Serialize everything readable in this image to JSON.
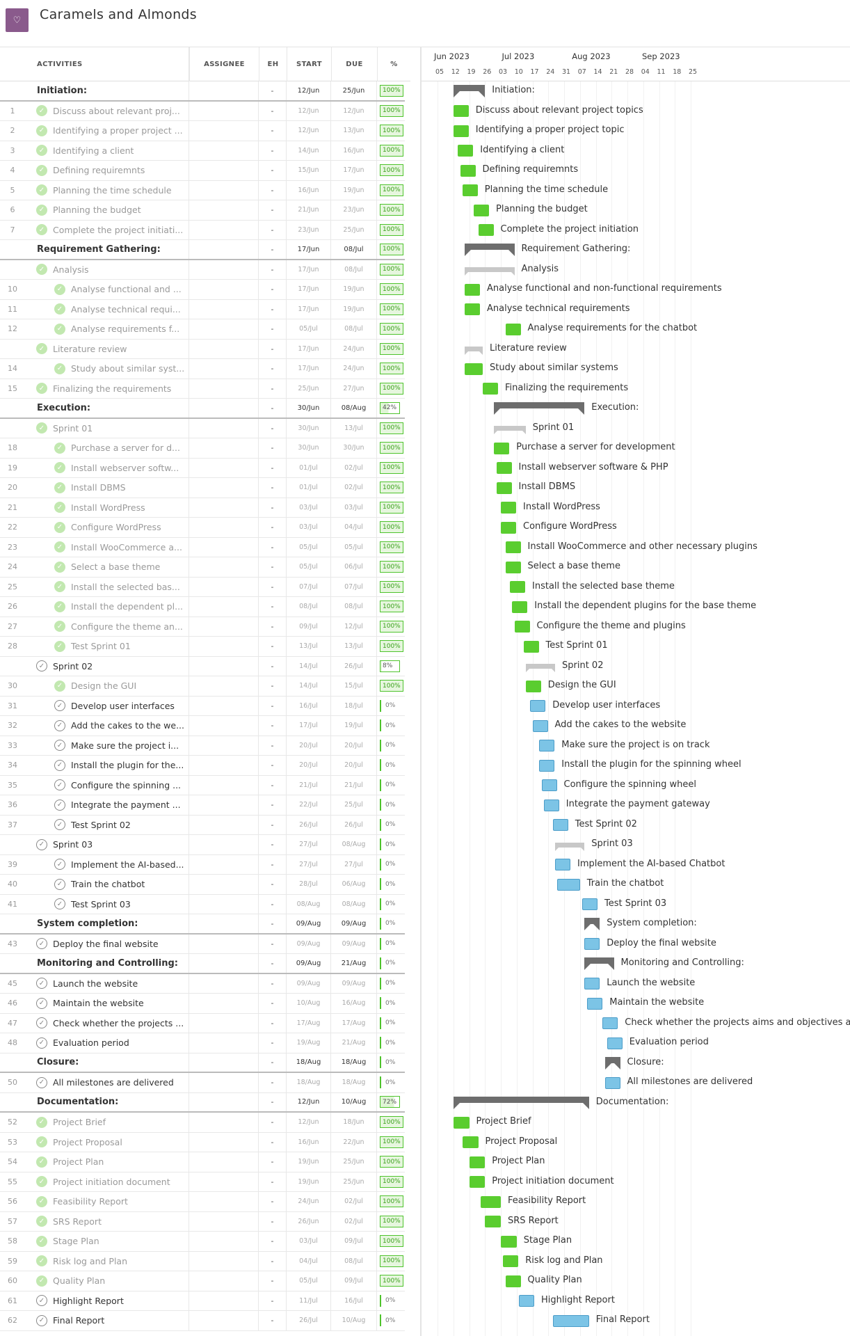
{
  "app": {
    "title": "Caramels and Almonds",
    "logo_icon": "heart-logo-icon"
  },
  "columns": {
    "activities": "ACTIVITIES",
    "assignee": "ASSIGNEE",
    "eh": "EH",
    "start": "START",
    "due": "DUE",
    "percent": "%"
  },
  "timeline": {
    "months": [
      "Jun 2023",
      "Jul 2023",
      "Aug 2023",
      "Sep 2023"
    ],
    "days": [
      "05",
      "12",
      "19",
      "26",
      "03",
      "10",
      "17",
      "24",
      "31",
      "07",
      "14",
      "21",
      "28",
      "04",
      "11",
      "18",
      "25"
    ]
  },
  "colors": {
    "done": "#5acd2f",
    "open": "#7cc4e6",
    "summary": "#6d6d6d",
    "subgroup": "#c8c8c8"
  },
  "rows": [
    {
      "num": "",
      "name": "Initiation:",
      "short": "Initiation:",
      "eh": "-",
      "start": "12/Jun",
      "due": "25/Jun",
      "pct": "100%",
      "type": "group",
      "level": 0
    },
    {
      "num": "1",
      "name": "Discuss about relevant project topics",
      "short": "Discuss about relevant proj...",
      "eh": "-",
      "start": "12/Jun",
      "due": "12/Jun",
      "pct": "100%",
      "type": "task",
      "level": 1
    },
    {
      "num": "2",
      "name": "Identifying a proper project topic",
      "short": "Identifying a proper project ...",
      "eh": "-",
      "start": "12/Jun",
      "due": "13/Jun",
      "pct": "100%",
      "type": "task",
      "level": 1
    },
    {
      "num": "3",
      "name": "Identifying a client",
      "short": "Identifying a client",
      "eh": "-",
      "start": "14/Jun",
      "due": "16/Jun",
      "pct": "100%",
      "type": "task",
      "level": 1
    },
    {
      "num": "4",
      "name": "Defining requiremnts",
      "short": "Defining requiremnts",
      "eh": "-",
      "start": "15/Jun",
      "due": "17/Jun",
      "pct": "100%",
      "type": "task",
      "level": 1
    },
    {
      "num": "5",
      "name": "Planning the time schedule",
      "short": "Planning the time schedule",
      "eh": "-",
      "start": "16/Jun",
      "due": "19/Jun",
      "pct": "100%",
      "type": "task",
      "level": 1
    },
    {
      "num": "6",
      "name": "Planning the budget",
      "short": "Planning the budget",
      "eh": "-",
      "start": "21/Jun",
      "due": "23/Jun",
      "pct": "100%",
      "type": "task",
      "level": 1
    },
    {
      "num": "7",
      "name": "Complete the project initiation",
      "short": "Complete the project initiati...",
      "eh": "-",
      "start": "23/Jun",
      "due": "25/Jun",
      "pct": "100%",
      "type": "task",
      "level": 1
    },
    {
      "num": "",
      "name": "Requirement Gathering:",
      "short": "Requirement Gathering:",
      "eh": "-",
      "start": "17/Jun",
      "due": "08/Jul",
      "pct": "100%",
      "type": "group",
      "level": 0
    },
    {
      "num": "",
      "name": "Analysis",
      "short": "Analysis",
      "eh": "-",
      "start": "17/Jun",
      "due": "08/Jul",
      "pct": "100%",
      "type": "sub",
      "level": 1
    },
    {
      "num": "10",
      "name": "Analyse functional and non-functional requirements",
      "short": "Analyse functional and ...",
      "eh": "-",
      "start": "17/Jun",
      "due": "19/Jun",
      "pct": "100%",
      "type": "task",
      "level": 2
    },
    {
      "num": "11",
      "name": "Analyse technical requirements",
      "short": "Analyse technical requi...",
      "eh": "-",
      "start": "17/Jun",
      "due": "19/Jun",
      "pct": "100%",
      "type": "task",
      "level": 2
    },
    {
      "num": "12",
      "name": "Analyse requirements for the chatbot",
      "short": "Analyse requirements f...",
      "eh": "-",
      "start": "05/Jul",
      "due": "08/Jul",
      "pct": "100%",
      "type": "task",
      "level": 2
    },
    {
      "num": "",
      "name": "Literature review",
      "short": "Literature review",
      "eh": "-",
      "start": "17/Jun",
      "due": "24/Jun",
      "pct": "100%",
      "type": "sub",
      "level": 1
    },
    {
      "num": "14",
      "name": "Study about similar systems",
      "short": "Study about similar syst...",
      "eh": "-",
      "start": "17/Jun",
      "due": "24/Jun",
      "pct": "100%",
      "type": "task",
      "level": 2
    },
    {
      "num": "15",
      "name": "Finalizing the requirements",
      "short": "Finalizing the requirements",
      "eh": "-",
      "start": "25/Jun",
      "due": "27/Jun",
      "pct": "100%",
      "type": "task",
      "level": 1
    },
    {
      "num": "",
      "name": "Execution:",
      "short": "Execution:",
      "eh": "-",
      "start": "30/Jun",
      "due": "08/Aug",
      "pct": "42%",
      "type": "group",
      "level": 0
    },
    {
      "num": "",
      "name": "Sprint 01",
      "short": "Sprint 01",
      "eh": "-",
      "start": "30/Jun",
      "due": "13/Jul",
      "pct": "100%",
      "type": "sub",
      "level": 1
    },
    {
      "num": "18",
      "name": "Purchase a server for development",
      "short": "Purchase a server for d...",
      "eh": "-",
      "start": "30/Jun",
      "due": "30/Jun",
      "pct": "100%",
      "type": "task",
      "level": 2
    },
    {
      "num": "19",
      "name": "Install webserver software & PHP",
      "short": "Install webserver softw...",
      "eh": "-",
      "start": "01/Jul",
      "due": "02/Jul",
      "pct": "100%",
      "type": "task",
      "level": 2
    },
    {
      "num": "20",
      "name": "Install DBMS",
      "short": "Install DBMS",
      "eh": "-",
      "start": "01/Jul",
      "due": "02/Jul",
      "pct": "100%",
      "type": "task",
      "level": 2
    },
    {
      "num": "21",
      "name": "Install WordPress",
      "short": "Install WordPress",
      "eh": "-",
      "start": "03/Jul",
      "due": "03/Jul",
      "pct": "100%",
      "type": "task",
      "level": 2
    },
    {
      "num": "22",
      "name": "Configure WordPress",
      "short": "Configure WordPress",
      "eh": "-",
      "start": "03/Jul",
      "due": "04/Jul",
      "pct": "100%",
      "type": "task",
      "level": 2
    },
    {
      "num": "23",
      "name": "Install WooCommerce and other necessary plugins",
      "short": "Install WooCommerce a...",
      "eh": "-",
      "start": "05/Jul",
      "due": "05/Jul",
      "pct": "100%",
      "type": "task",
      "level": 2
    },
    {
      "num": "24",
      "name": "Select a base theme",
      "short": "Select a base theme",
      "eh": "-",
      "start": "05/Jul",
      "due": "06/Jul",
      "pct": "100%",
      "type": "task",
      "level": 2
    },
    {
      "num": "25",
      "name": "Install the selected base theme",
      "short": "Install the selected bas...",
      "eh": "-",
      "start": "07/Jul",
      "due": "07/Jul",
      "pct": "100%",
      "type": "task",
      "level": 2
    },
    {
      "num": "26",
      "name": "Install the dependent plugins for the base theme",
      "short": "Install the dependent pl...",
      "eh": "-",
      "start": "08/Jul",
      "due": "08/Jul",
      "pct": "100%",
      "type": "task",
      "level": 2
    },
    {
      "num": "27",
      "name": "Configure the theme and plugins",
      "short": "Configure the theme an...",
      "eh": "-",
      "start": "09/Jul",
      "due": "12/Jul",
      "pct": "100%",
      "type": "task",
      "level": 2
    },
    {
      "num": "28",
      "name": "Test Sprint 01",
      "short": "Test Sprint 01",
      "eh": "-",
      "start": "13/Jul",
      "due": "13/Jul",
      "pct": "100%",
      "type": "task",
      "level": 2
    },
    {
      "num": "",
      "name": "Sprint 02",
      "short": "Sprint 02",
      "eh": "-",
      "start": "14/Jul",
      "due": "26/Jul",
      "pct": "8%",
      "type": "sub",
      "level": 1
    },
    {
      "num": "30",
      "name": "Design the GUI",
      "short": "Design the GUI",
      "eh": "-",
      "start": "14/Jul",
      "due": "15/Jul",
      "pct": "100%",
      "type": "task",
      "level": 2
    },
    {
      "num": "31",
      "name": "Develop user interfaces",
      "short": "Develop user interfaces",
      "eh": "-",
      "start": "16/Jul",
      "due": "18/Jul",
      "pct": "0%",
      "type": "task",
      "level": 2
    },
    {
      "num": "32",
      "name": "Add the cakes to the website",
      "short": "Add the cakes to the we...",
      "eh": "-",
      "start": "17/Jul",
      "due": "19/Jul",
      "pct": "0%",
      "type": "task",
      "level": 2
    },
    {
      "num": "33",
      "name": "Make sure the project is on track",
      "short": "Make sure the project i...",
      "eh": "-",
      "start": "20/Jul",
      "due": "20/Jul",
      "pct": "0%",
      "type": "task",
      "level": 2
    },
    {
      "num": "34",
      "name": "Install the plugin for the spinning wheel",
      "short": "Install the plugin for the...",
      "eh": "-",
      "start": "20/Jul",
      "due": "20/Jul",
      "pct": "0%",
      "type": "task",
      "level": 2
    },
    {
      "num": "35",
      "name": "Configure the spinning wheel",
      "short": "Configure the spinning ...",
      "eh": "-",
      "start": "21/Jul",
      "due": "21/Jul",
      "pct": "0%",
      "type": "task",
      "level": 2
    },
    {
      "num": "36",
      "name": "Integrate the payment gateway",
      "short": "Integrate the payment ...",
      "eh": "-",
      "start": "22/Jul",
      "due": "25/Jul",
      "pct": "0%",
      "type": "task",
      "level": 2
    },
    {
      "num": "37",
      "name": "Test Sprint 02",
      "short": "Test Sprint 02",
      "eh": "-",
      "start": "26/Jul",
      "due": "26/Jul",
      "pct": "0%",
      "type": "task",
      "level": 2
    },
    {
      "num": "",
      "name": "Sprint 03",
      "short": "Sprint 03",
      "eh": "-",
      "start": "27/Jul",
      "due": "08/Aug",
      "pct": "0%",
      "type": "sub",
      "level": 1
    },
    {
      "num": "39",
      "name": "Implement the AI-based Chatbot",
      "short": "Implement the AI-based...",
      "eh": "-",
      "start": "27/Jul",
      "due": "27/Jul",
      "pct": "0%",
      "type": "task",
      "level": 2
    },
    {
      "num": "40",
      "name": "Train the chatbot",
      "short": "Train the chatbot",
      "eh": "-",
      "start": "28/Jul",
      "due": "06/Aug",
      "pct": "0%",
      "type": "task",
      "level": 2
    },
    {
      "num": "41",
      "name": "Test Sprint 03",
      "short": "Test Sprint 03",
      "eh": "-",
      "start": "08/Aug",
      "due": "08/Aug",
      "pct": "0%",
      "type": "task",
      "level": 2
    },
    {
      "num": "",
      "name": "System completion:",
      "short": "System completion:",
      "eh": "-",
      "start": "09/Aug",
      "due": "09/Aug",
      "pct": "0%",
      "type": "group",
      "level": 0
    },
    {
      "num": "43",
      "name": "Deploy the final website",
      "short": "Deploy the final website",
      "eh": "-",
      "start": "09/Aug",
      "due": "09/Aug",
      "pct": "0%",
      "type": "task",
      "level": 1
    },
    {
      "num": "",
      "name": "Monitoring and Controlling:",
      "short": "Monitoring and Controlling:",
      "eh": "-",
      "start": "09/Aug",
      "due": "21/Aug",
      "pct": "0%",
      "type": "group",
      "level": 0
    },
    {
      "num": "45",
      "name": "Launch the website",
      "short": "Launch the website",
      "eh": "-",
      "start": "09/Aug",
      "due": "09/Aug",
      "pct": "0%",
      "type": "task",
      "level": 1
    },
    {
      "num": "46",
      "name": "Maintain the website",
      "short": "Maintain the website",
      "eh": "-",
      "start": "10/Aug",
      "due": "16/Aug",
      "pct": "0%",
      "type": "task",
      "level": 1
    },
    {
      "num": "47",
      "name": "Check whether the projects aims and objectives are met",
      "short": "Check whether the projects ...",
      "eh": "-",
      "start": "17/Aug",
      "due": "17/Aug",
      "pct": "0%",
      "type": "task",
      "level": 1
    },
    {
      "num": "48",
      "name": "Evaluation period",
      "short": "Evaluation period",
      "eh": "-",
      "start": "19/Aug",
      "due": "21/Aug",
      "pct": "0%",
      "type": "task",
      "level": 1
    },
    {
      "num": "",
      "name": "Closure:",
      "short": "Closure:",
      "eh": "-",
      "start": "18/Aug",
      "due": "18/Aug",
      "pct": "0%",
      "type": "group",
      "level": 0
    },
    {
      "num": "50",
      "name": "All milestones are delivered",
      "short": "All milestones are delivered",
      "eh": "-",
      "start": "18/Aug",
      "due": "18/Aug",
      "pct": "0%",
      "type": "task",
      "level": 1
    },
    {
      "num": "",
      "name": "Documentation:",
      "short": "Documentation:",
      "eh": "-",
      "start": "12/Jun",
      "due": "10/Aug",
      "pct": "72%",
      "type": "group",
      "level": 0
    },
    {
      "num": "52",
      "name": "Project Brief",
      "short": "Project Brief",
      "eh": "-",
      "start": "12/Jun",
      "due": "18/Jun",
      "pct": "100%",
      "type": "task",
      "level": 1
    },
    {
      "num": "53",
      "name": "Project Proposal",
      "short": "Project Proposal",
      "eh": "-",
      "start": "16/Jun",
      "due": "22/Jun",
      "pct": "100%",
      "type": "task",
      "level": 1
    },
    {
      "num": "54",
      "name": "Project Plan",
      "short": "Project Plan",
      "eh": "-",
      "start": "19/Jun",
      "due": "25/Jun",
      "pct": "100%",
      "type": "task",
      "level": 1
    },
    {
      "num": "55",
      "name": "Project initiation document",
      "short": "Project initiation document",
      "eh": "-",
      "start": "19/Jun",
      "due": "25/Jun",
      "pct": "100%",
      "type": "task",
      "level": 1
    },
    {
      "num": "56",
      "name": "Feasibility Report",
      "short": "Feasibility Report",
      "eh": "-",
      "start": "24/Jun",
      "due": "02/Jul",
      "pct": "100%",
      "type": "task",
      "level": 1
    },
    {
      "num": "57",
      "name": "SRS Report",
      "short": "SRS Report",
      "eh": "-",
      "start": "26/Jun",
      "due": "02/Jul",
      "pct": "100%",
      "type": "task",
      "level": 1
    },
    {
      "num": "58",
      "name": "Stage Plan",
      "short": "Stage Plan",
      "eh": "-",
      "start": "03/Jul",
      "due": "09/Jul",
      "pct": "100%",
      "type": "task",
      "level": 1
    },
    {
      "num": "59",
      "name": "Risk log and Plan",
      "short": "Risk log and Plan",
      "eh": "-",
      "start": "04/Jul",
      "due": "08/Jul",
      "pct": "100%",
      "type": "task",
      "level": 1
    },
    {
      "num": "60",
      "name": "Quality Plan",
      "short": "Quality Plan",
      "eh": "-",
      "start": "05/Jul",
      "due": "09/Jul",
      "pct": "100%",
      "type": "task",
      "level": 1
    },
    {
      "num": "61",
      "name": "Highlight Report",
      "short": "Highlight Report",
      "eh": "-",
      "start": "11/Jul",
      "due": "16/Jul",
      "pct": "0%",
      "type": "task",
      "level": 1
    },
    {
      "num": "62",
      "name": "Final Report",
      "short": "Final Report",
      "eh": "-",
      "start": "26/Jul",
      "due": "10/Aug",
      "pct": "0%",
      "type": "task",
      "level": 1
    }
  ]
}
